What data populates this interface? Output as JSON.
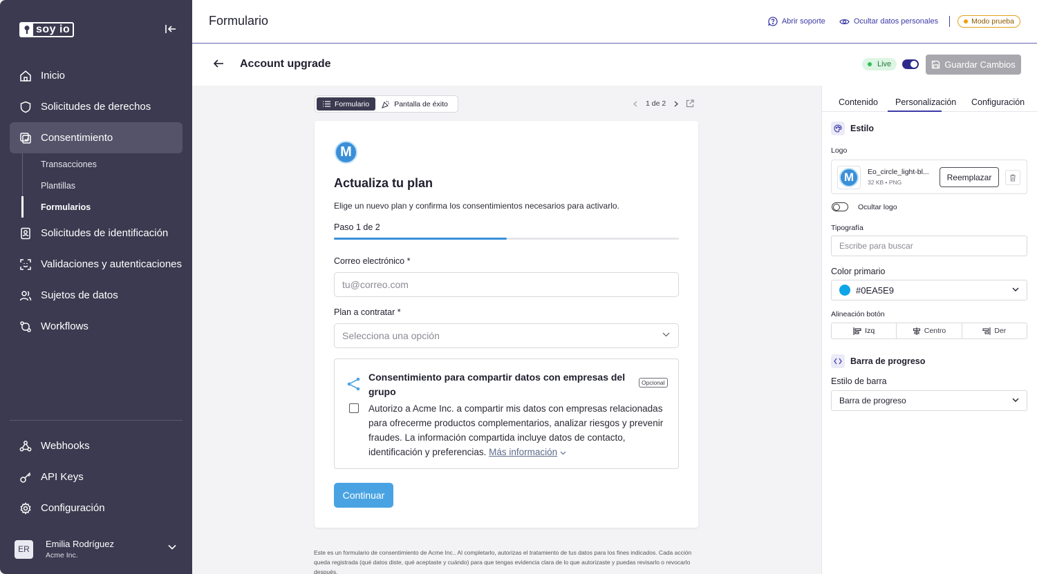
{
  "brand": {
    "logo_text": "soy io"
  },
  "sidebar": {
    "items": [
      {
        "label": "Inicio",
        "icon": "home-icon"
      },
      {
        "label": "Solicitudes de derechos",
        "icon": "shield-icon"
      },
      {
        "label": "Consentimiento",
        "icon": "consent-icon",
        "active": true
      },
      {
        "label": "Solicitudes de identificación",
        "icon": "id-card-icon"
      },
      {
        "label": "Validaciones y autenticaciones",
        "icon": "face-scan-icon"
      },
      {
        "label": "Sujetos de datos",
        "icon": "users-icon"
      },
      {
        "label": "Workflows",
        "icon": "workflow-icon"
      }
    ],
    "subitems": [
      {
        "label": "Transacciones"
      },
      {
        "label": "Plantillas"
      },
      {
        "label": "Formularios",
        "active": true
      }
    ],
    "bottom_items": [
      {
        "label": "Webhooks",
        "icon": "webhook-icon"
      },
      {
        "label": "API Keys",
        "icon": "key-icon"
      },
      {
        "label": "Configuración",
        "icon": "gear-icon"
      }
    ],
    "user": {
      "initials": "ER",
      "name": "Emilia Rodríguez",
      "org": "Acme Inc."
    }
  },
  "header": {
    "title": "Formulario",
    "support": "Abrir soporte",
    "hide_data": "Ocultar datos personales",
    "test_mode": "Modo prueba"
  },
  "subheader": {
    "title": "Account upgrade",
    "live": "Live",
    "save": "Guardar Cambios"
  },
  "canvas": {
    "tab_form": "Formulario",
    "tab_success": "Pantalla de éxito",
    "pager": "1 de 2",
    "form": {
      "logo_letter": "M",
      "title": "Actualiza tu plan",
      "description": "Elige un nuevo plan y confirma los consentimientos necesarios para activarlo.",
      "step": "Paso 1 de 2",
      "progress": 0.5,
      "email_label": "Correo electrónico *",
      "email_placeholder": "tu@correo.com",
      "plan_label": "Plan a contratar *",
      "plan_placeholder": "Selecciona una opción",
      "consent_title": "Consentimiento para compartir datos con empresas del grupo",
      "consent_optional": "Opcional",
      "consent_text": "Autorizo a Acme Inc. a compartir mis datos con empresas relacionadas para ofrecerme productos complementarios, analizar riesgos y prevenir fraudes. La información compartida incluye datos de contacto, identificación y preferencias.",
      "consent_more": "Más información",
      "continue": "Continuar"
    },
    "legal": "Este es un formulario de consentimiento de Acme Inc.. Al completarlo, autorizas el tratamiento de tus datos para los fines indicados. Cada acción queda registrada (qué datos diste, qué aceptaste y cuándo) para que tengas evidencia clara de lo que autorizaste y puedas revisarlo o revocarlo después."
  },
  "panel": {
    "tabs": [
      "Contenido",
      "Personalización",
      "Configuración"
    ],
    "style_title": "Estilo",
    "logo_label": "Logo",
    "file_name": "Eo_circle_light-bl...",
    "file_meta": "32 KB • PNG",
    "replace": "Reemplazar",
    "hide_logo": "Ocultar logo",
    "typography_label": "Tipografía",
    "typography_placeholder": "Escribe para buscar",
    "primary_color_label": "Color primario",
    "primary_color": "#0EA5E9",
    "align_label": "Alineación botón",
    "align_options": [
      "Izq",
      "Centro",
      "Der"
    ],
    "progress_title": "Barra de progreso",
    "bar_style_label": "Estilo de barra",
    "bar_style_value": "Barra de progreso"
  },
  "colors": {
    "sidebar": "#3b3a50",
    "accent": "#3c3aa6",
    "form_primary": "#49a3e3"
  }
}
